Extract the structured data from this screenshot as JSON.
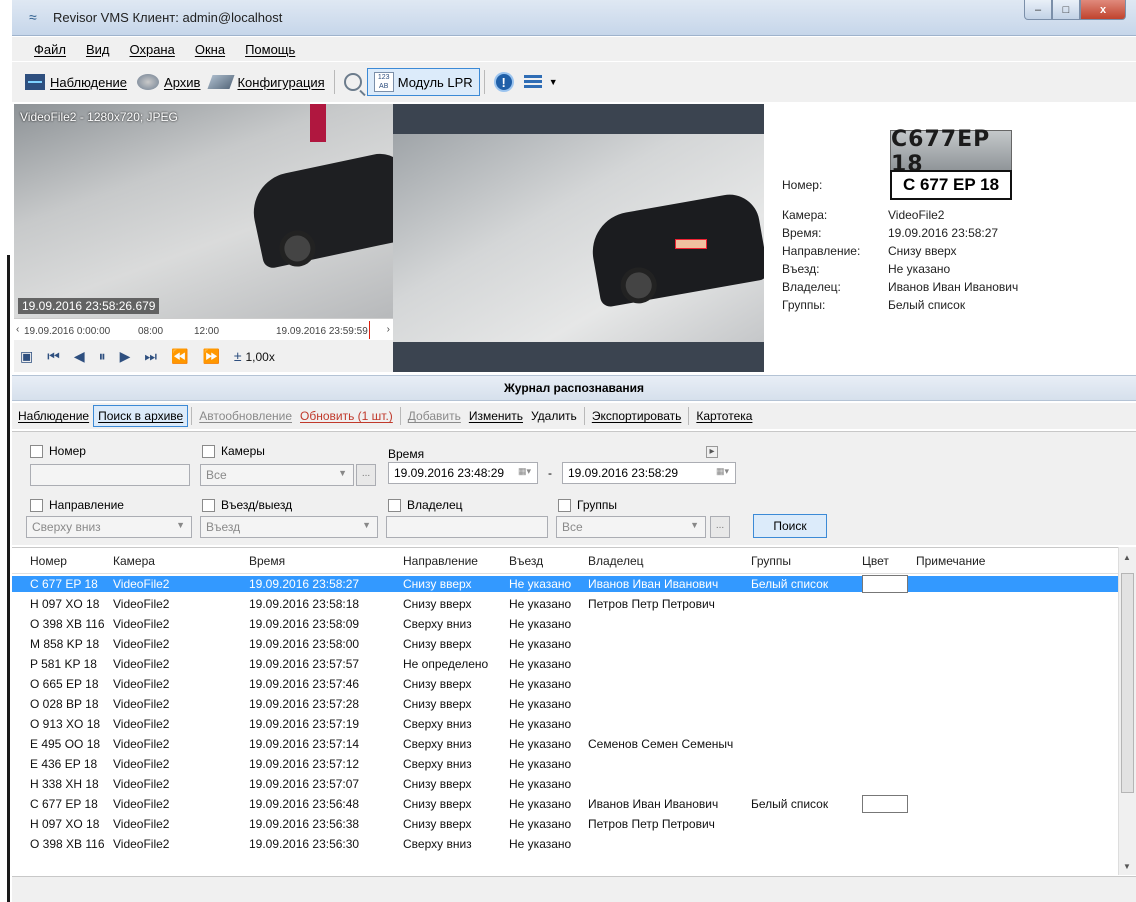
{
  "window": {
    "title": "Revisor VMS Клиент: admin@localhost",
    "min_label": "–",
    "max_label": "□",
    "close_label": "x"
  },
  "menu": [
    "Файл",
    "Вид",
    "Охрана",
    "Окна",
    "Помощь"
  ],
  "toolbar": {
    "watch": "Наблюдение",
    "archive": "Архив",
    "config": "Конфигурация",
    "lpr": "Модуль LPR",
    "lpr_icon_text": "123 AB"
  },
  "video": {
    "source_label": "VideoFile2 - 1280x720; JPEG",
    "timestamp": "19.09.2016 23:58:26.679",
    "timeline": [
      "19.09.2016 0:00:00",
      "08:00",
      "12:00",
      "19.09.2016 23:59:59"
    ],
    "speed": "1,00x"
  },
  "plate_image_text": "C677EP 18",
  "details": {
    "number_label": "Номер:",
    "number": "C 677 EP 18",
    "rows": [
      {
        "k": "Камера:",
        "v": "VideoFile2"
      },
      {
        "k": "Время:",
        "v": "19.09.2016 23:58:27"
      },
      {
        "k": "Направление:",
        "v": "Снизу вверх"
      },
      {
        "k": "Въезд:",
        "v": "Не указано"
      },
      {
        "k": "Владелец:",
        "v": "Иванов Иван Иванович"
      },
      {
        "k": "Группы:",
        "v": "Белый список"
      }
    ]
  },
  "journal_title": "Журнал распознавания",
  "log_toolbar": {
    "watch": "Наблюдение",
    "search_archive": "Поиск в архиве",
    "auto_update": "Автообновление",
    "refresh": "Обновить (1 шт.)",
    "add": "Добавить",
    "edit": "Изменить",
    "delete": "Удалить",
    "export": "Экспортировать",
    "cards": "Картотека"
  },
  "filter": {
    "number_label": "Номер",
    "number_value": "",
    "cameras_label": "Камеры",
    "cameras_value": "Все",
    "time_label": "Время",
    "time_from": "19.09.2016 23:48:29",
    "time_dash": "-",
    "time_to": "19.09.2016 23:58:29",
    "direction_label": "Направление",
    "direction_value": "Сверху вниз",
    "entry_label": "Въезд/выезд",
    "entry_value": "Въезд",
    "owner_label": "Владелец",
    "owner_value": "",
    "groups_label": "Группы",
    "groups_value": "Все",
    "more": "...",
    "search_button": "Поиск"
  },
  "table": {
    "columns": [
      "Номер",
      "Камера",
      "Время",
      "Направление",
      "Въезд",
      "Владелец",
      "Группы",
      "Цвет",
      "Примечание"
    ],
    "rows": [
      [
        "C 677 EP 18",
        "VideoFile2",
        "19.09.2016 23:58:27",
        "Снизу вверх",
        "Не указано",
        "Иванов Иван Иванович",
        "Белый список",
        "white",
        ""
      ],
      [
        "H 097 XO 18",
        "VideoFile2",
        "19.09.2016 23:58:18",
        "Снизу вверх",
        "Не указано",
        "Петров Петр Петрович",
        "",
        "",
        ""
      ],
      [
        "O 398 XB 116",
        "VideoFile2",
        "19.09.2016 23:58:09",
        "Сверху вниз",
        "Не указано",
        "",
        "",
        "",
        ""
      ],
      [
        "M 858 KP 18",
        "VideoFile2",
        "19.09.2016 23:58:00",
        "Снизу вверх",
        "Не указано",
        "",
        "",
        "",
        ""
      ],
      [
        "P 581 KP 18",
        "VideoFile2",
        "19.09.2016 23:57:57",
        "Не определено",
        "Не указано",
        "",
        "",
        "",
        ""
      ],
      [
        "O 665 EP 18",
        "VideoFile2",
        "19.09.2016 23:57:46",
        "Снизу вверх",
        "Не указано",
        "",
        "",
        "",
        ""
      ],
      [
        "O 028 BP 18",
        "VideoFile2",
        "19.09.2016 23:57:28",
        "Снизу вверх",
        "Не указано",
        "",
        "",
        "",
        ""
      ],
      [
        "O 913 XO 18",
        "VideoFile2",
        "19.09.2016 23:57:19",
        "Сверху вниз",
        "Не указано",
        "",
        "",
        "",
        ""
      ],
      [
        "E 495 OO 18",
        "VideoFile2",
        "19.09.2016 23:57:14",
        "Сверху вниз",
        "Не указано",
        "Семенов Семен Семеныч",
        "",
        "",
        ""
      ],
      [
        "E 436 EP 18",
        "VideoFile2",
        "19.09.2016 23:57:12",
        "Сверху вниз",
        "Не указано",
        "",
        "",
        "",
        ""
      ],
      [
        "H 338 XH 18",
        "VideoFile2",
        "19.09.2016 23:57:07",
        "Снизу вверх",
        "Не указано",
        "",
        "",
        "",
        ""
      ],
      [
        "C 677 EP 18",
        "VideoFile2",
        "19.09.2016 23:56:48",
        "Снизу вверх",
        "Не указано",
        "Иванов Иван Иванович",
        "Белый список",
        "white",
        ""
      ],
      [
        "H 097 XO 18",
        "VideoFile2",
        "19.09.2016 23:56:38",
        "Снизу вверх",
        "Не указано",
        "Петров Петр Петрович",
        "",
        "",
        ""
      ],
      [
        "O 398 XB 116",
        "VideoFile2",
        "19.09.2016 23:56:30",
        "Сверху вниз",
        "Не указано",
        "",
        "",
        "",
        ""
      ]
    ]
  }
}
